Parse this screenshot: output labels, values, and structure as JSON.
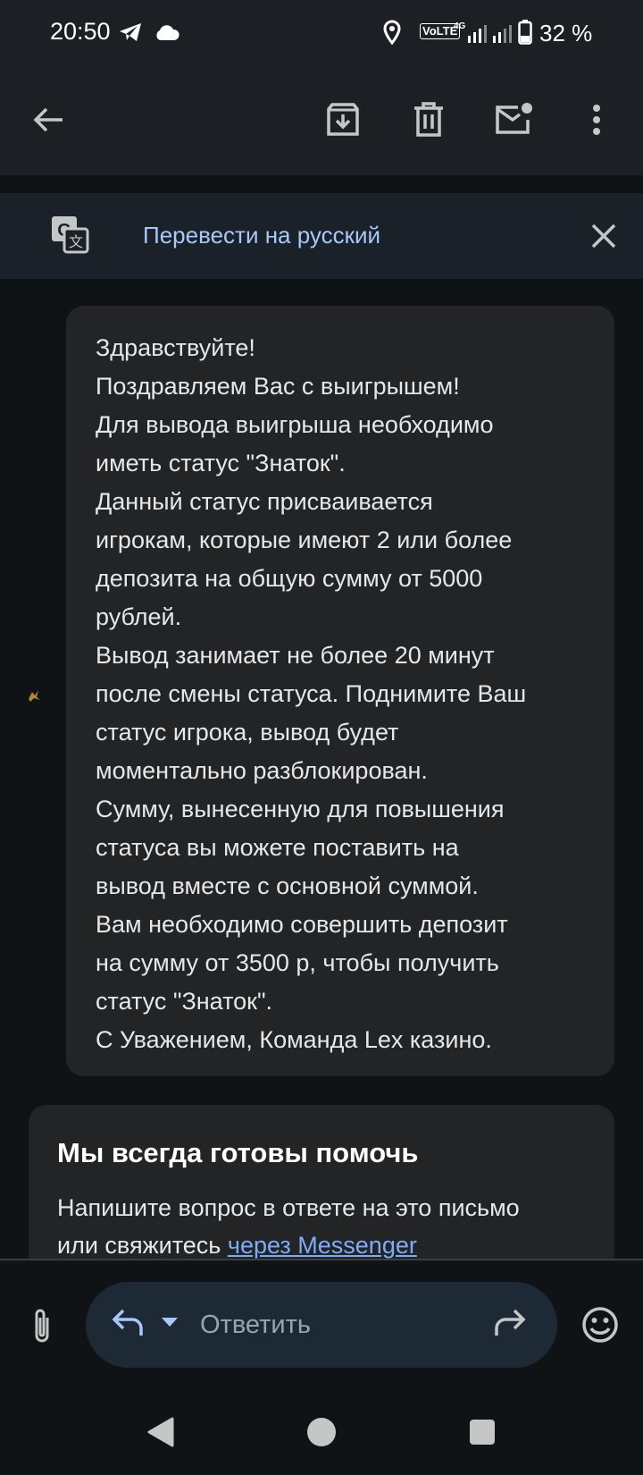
{
  "status_bar": {
    "time": "20:50",
    "volte": "VoLTE",
    "network": "4G",
    "battery": "32 %"
  },
  "toolbar": {
    "icons": [
      "back-arrow-icon",
      "archive-icon",
      "trash-icon",
      "mark-unread-icon",
      "more-vert-icon"
    ]
  },
  "translate": {
    "label": "Перевести на русский"
  },
  "message": {
    "lines": [
      "Здравствуйте!",
      "Поздравляем Вас с выигрышем!",
      "Для вывода выигрыша необходимо",
      "иметь статус \"Знаток\".",
      "Данный статус присваивается",
      "игрокам, которые имеют 2 или более",
      "депозита на общую сумму от 5000",
      "рублей.",
      "Вывод занимает не более 20 минут",
      "после смены статуса. Поднимите Ваш",
      "статус игрока, вывод будет",
      "моментально разблокирован.",
      "Сумму, вынесенную для повышения",
      "статуса вы можете поставить на",
      "вывод вместе с основной суммой.",
      "Вам необходимо совершить депозит",
      "на сумму от 3500 р, чтобы получить",
      "статус \"Знаток\".",
      "С Уважением, Команда Lex казино."
    ]
  },
  "help": {
    "title": "Мы всегда готовы помочь",
    "line1": "Напишите вопрос в ответе на это письмо",
    "line2_prefix": "или свяжитесь ",
    "link": "через Messenger"
  },
  "reply": {
    "placeholder": "Ответить"
  },
  "colors": {
    "background": "#0f1316",
    "bubble": "#232426",
    "accent": "#a8c7fa",
    "link": "#7cacf8"
  }
}
